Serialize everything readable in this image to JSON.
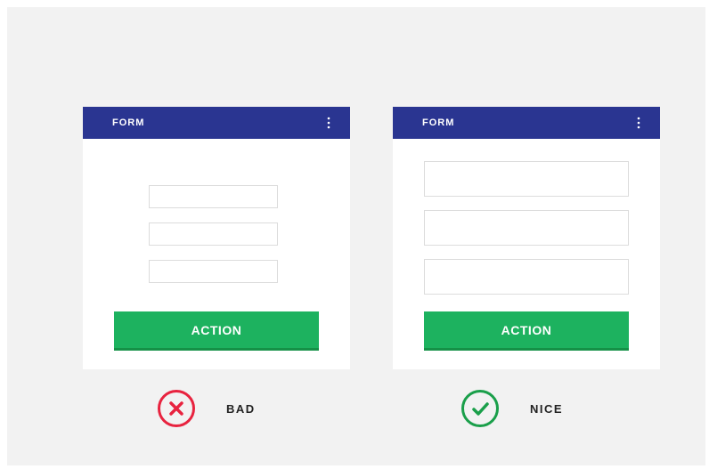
{
  "examples": [
    {
      "id": "bad",
      "header": {
        "title": "FORM",
        "menu_icon": "kebab-menu-icon"
      },
      "fields": [
        "",
        "",
        ""
      ],
      "action_label": "ACTION",
      "verdict": {
        "label": "BAD",
        "icon": "cross-circle-icon",
        "color": "#e8233f"
      }
    },
    {
      "id": "nice",
      "header": {
        "title": "FORM",
        "menu_icon": "kebab-menu-icon"
      },
      "fields": [
        "",
        "",
        ""
      ],
      "action_label": "ACTION",
      "verdict": {
        "label": "NICE",
        "icon": "check-circle-icon",
        "color": "#1a9f4a"
      }
    }
  ],
  "colors": {
    "header": "#2a3591",
    "action": "#1db25f",
    "background": "#f2f2f2",
    "card": "#ffffff"
  }
}
